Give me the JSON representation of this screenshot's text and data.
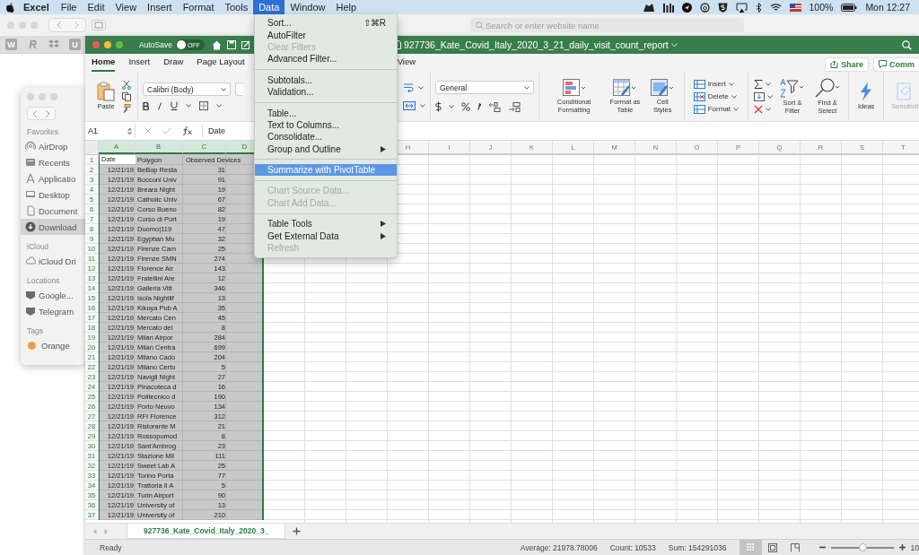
{
  "menubar": {
    "app": "Excel",
    "items": [
      {
        "label": "File",
        "selected": false
      },
      {
        "label": "Edit",
        "selected": false
      },
      {
        "label": "View",
        "selected": false
      },
      {
        "label": "Insert",
        "selected": false
      },
      {
        "label": "Format",
        "selected": false
      },
      {
        "label": "Tools",
        "selected": false
      },
      {
        "label": "Data",
        "selected": true
      },
      {
        "label": "Window",
        "selected": false
      },
      {
        "label": "Help",
        "selected": false
      }
    ],
    "battery": "100%",
    "clock": "Mon 12:27"
  },
  "browser": {
    "search": {
      "placeholder": "Search or enter website name"
    },
    "bookmarks": [
      {
        "kind": "letter",
        "label": "W"
      },
      {
        "kind": "italic",
        "label": "R"
      },
      {
        "kind": "dropbox"
      },
      {
        "kind": "letter",
        "label": "U"
      }
    ]
  },
  "finder": {
    "sections": [
      {
        "title": "Favorites",
        "items": [
          {
            "label": "AirDrop",
            "kind": "airdrop",
            "selected": false
          },
          {
            "label": "Recents",
            "kind": "recents",
            "selected": false
          },
          {
            "label": "Applicatio",
            "kind": "applications",
            "selected": false
          },
          {
            "label": "Desktop",
            "kind": "desktop",
            "selected": false
          },
          {
            "label": "Document",
            "kind": "documents",
            "selected": false
          },
          {
            "label": "Download",
            "kind": "downloads",
            "selected": true
          }
        ]
      },
      {
        "title": "iCloud",
        "items": [
          {
            "label": "iCloud Dri",
            "kind": "cloud",
            "selected": false
          }
        ]
      },
      {
        "title": "Locations",
        "items": [
          {
            "label": "Google...",
            "kind": "drive",
            "selected": false
          },
          {
            "label": "Telegram",
            "kind": "drive",
            "selected": false
          }
        ]
      },
      {
        "title": "Tags",
        "items": [
          {
            "label": "Orange",
            "kind": "tag",
            "color": "#f0a044",
            "selected": false
          }
        ]
      }
    ]
  },
  "excel": {
    "autosave": {
      "label": "AutoSave",
      "on": false,
      "state": "OFF"
    },
    "title": "927736_Kate_Covid_Italy_2020_3_21_daily_visit_count_report",
    "tabs": [
      {
        "label": "Home",
        "selected": true
      },
      {
        "label": "Insert",
        "selected": false
      },
      {
        "label": "Draw",
        "selected": false
      },
      {
        "label": "Page Layout",
        "selected": false
      },
      {
        "label": "View",
        "selected": false
      }
    ],
    "share": "Share",
    "comments": "Comm",
    "ribbon": {
      "paste": "Paste",
      "font": "Calibri (Body)",
      "number_format": "General",
      "style_buttons": [
        "Conditional Formatting",
        "Format as Table",
        "Cell Styles"
      ],
      "cell_buttons": [
        "Insert",
        "Delete",
        "Format"
      ],
      "sort_filter": "Sort & Filter",
      "find_select": "Find & Select",
      "ideas": "Ideas",
      "sensitivity": "Sensitivit"
    },
    "formula_bar": {
      "name_box": "A1",
      "formula": "Date"
    },
    "columns_left": [
      {
        "label": "A",
        "selected": true
      },
      {
        "label": "B",
        "selected": true
      },
      {
        "label": "C",
        "selected": true
      },
      {
        "label": "D",
        "selected": true
      }
    ],
    "columns_right": [
      {
        "label": "H",
        "selected": false
      },
      {
        "label": "I",
        "selected": false
      },
      {
        "label": "J",
        "selected": false
      },
      {
        "label": "K",
        "selected": false
      },
      {
        "label": "L",
        "selected": false
      },
      {
        "label": "M",
        "selected": false
      },
      {
        "label": "N",
        "selected": false
      },
      {
        "label": "O",
        "selected": false
      },
      {
        "label": "P",
        "selected": false
      },
      {
        "label": "Q",
        "selected": false
      },
      {
        "label": "R",
        "selected": false
      },
      {
        "label": "S",
        "selected": false
      },
      {
        "label": "T",
        "selected": false
      }
    ],
    "rows": [
      {
        "number": "1",
        "cells": [
          "Date",
          "Polygon",
          "Observed Devices"
        ],
        "active": true
      },
      {
        "number": "2",
        "cells": [
          "12/21/19",
          "BeBop Resta",
          "31"
        ],
        "active": false
      },
      {
        "number": "3",
        "cells": [
          "12/21/19",
          "Bocconi Univ",
          "91"
        ],
        "active": false
      },
      {
        "number": "4",
        "cells": [
          "12/21/19",
          "Breara Night",
          "19"
        ],
        "active": false
      },
      {
        "number": "5",
        "cells": [
          "12/21/19",
          "Catholic Univ",
          "67"
        ],
        "active": false
      },
      {
        "number": "6",
        "cells": [
          "12/21/19",
          "Corso Bueno",
          "82"
        ],
        "active": false
      },
      {
        "number": "7",
        "cells": [
          "12/21/19",
          "Corso di Port",
          "19"
        ],
        "active": false
      },
      {
        "number": "8",
        "cells": [
          "12/21/19",
          "Duomo|119",
          "47"
        ],
        "active": false
      },
      {
        "number": "9",
        "cells": [
          "12/21/19",
          "Egyptian Mu",
          "32"
        ],
        "active": false
      },
      {
        "number": "10",
        "cells": [
          "12/21/19",
          "Firenze Cam",
          "25"
        ],
        "active": false
      },
      {
        "number": "11",
        "cells": [
          "12/21/19",
          "Firenze SMN",
          "274"
        ],
        "active": false
      },
      {
        "number": "12",
        "cells": [
          "12/21/19",
          "Florence Air",
          "143"
        ],
        "active": false
      },
      {
        "number": "13",
        "cells": [
          "12/21/19",
          "Fratellini Are",
          "12"
        ],
        "active": false
      },
      {
        "number": "14",
        "cells": [
          "12/21/19",
          "Galleria Vitt",
          "346"
        ],
        "active": false
      },
      {
        "number": "15",
        "cells": [
          "12/21/19",
          "Isola Nightlif",
          "13"
        ],
        "active": false
      },
      {
        "number": "16",
        "cells": [
          "12/21/19",
          "Kikuya Pub A",
          "35"
        ],
        "active": false
      },
      {
        "number": "17",
        "cells": [
          "12/21/19",
          "Mercato Cen",
          "45"
        ],
        "active": false
      },
      {
        "number": "18",
        "cells": [
          "12/21/19",
          "Mercato del",
          "8"
        ],
        "active": false
      },
      {
        "number": "19",
        "cells": [
          "12/21/19",
          "Milan Airpor",
          "284"
        ],
        "active": false
      },
      {
        "number": "20",
        "cells": [
          "12/21/19",
          "Milan Centra",
          "699"
        ],
        "active": false
      },
      {
        "number": "21",
        "cells": [
          "12/21/19",
          "Milano Cado",
          "204"
        ],
        "active": false
      },
      {
        "number": "22",
        "cells": [
          "12/21/19",
          "Milano Certo",
          "5"
        ],
        "active": false
      },
      {
        "number": "23",
        "cells": [
          "12/21/19",
          "Navigli Night",
          "27"
        ],
        "active": false
      },
      {
        "number": "24",
        "cells": [
          "12/21/19",
          "Pinacoteca d",
          "16"
        ],
        "active": false
      },
      {
        "number": "25",
        "cells": [
          "12/21/19",
          "Politecnico d",
          "190"
        ],
        "active": false
      },
      {
        "number": "26",
        "cells": [
          "12/21/19",
          "Porto Neuvo",
          "134"
        ],
        "active": false
      },
      {
        "number": "27",
        "cells": [
          "12/21/19",
          "RFI Florence",
          "312"
        ],
        "active": false
      },
      {
        "number": "28",
        "cells": [
          "12/21/19",
          "Ristorante M",
          "21"
        ],
        "active": false
      },
      {
        "number": "29",
        "cells": [
          "12/21/19",
          "Rossopomod",
          "8"
        ],
        "active": false
      },
      {
        "number": "30",
        "cells": [
          "12/21/19",
          "Sant'Ambrog",
          "23"
        ],
        "active": false
      },
      {
        "number": "31",
        "cells": [
          "12/21/19",
          "Stazione Mil",
          "111"
        ],
        "active": false
      },
      {
        "number": "32",
        "cells": [
          "12/21/19",
          "Sweet Lab A",
          "25"
        ],
        "active": false
      },
      {
        "number": "33",
        "cells": [
          "12/21/19",
          "Torino Porta",
          "77"
        ],
        "active": false
      },
      {
        "number": "34",
        "cells": [
          "12/21/19",
          "Trattoria Il A",
          "5"
        ],
        "active": false
      },
      {
        "number": "35",
        "cells": [
          "12/21/19",
          "Turin Airport",
          "90"
        ],
        "active": false
      },
      {
        "number": "36",
        "cells": [
          "12/21/19",
          "University of",
          "13"
        ],
        "active": false
      },
      {
        "number": "37",
        "cells": [
          "12/21/19",
          "University of",
          "210"
        ],
        "active": false
      }
    ],
    "sheet_tabs": [
      {
        "label": "927736_Kate_Covid_Italy_2020_3_",
        "selected": true
      }
    ],
    "status": {
      "mode": "Ready",
      "average": "Average: 21978.78006",
      "count": "Count: 10533",
      "sum": "Sum: 154291036",
      "views": [
        {
          "kind": "normal",
          "selected": true
        },
        {
          "kind": "page_break",
          "selected": false
        },
        {
          "kind": "page_layout",
          "selected": false
        }
      ],
      "zoom": {
        "level": 0.5,
        "reading": "10"
      }
    }
  },
  "data_menu": [
    {
      "kind": "item",
      "label": "Sort...",
      "shortcut": "⇧⌘R",
      "disabled": false,
      "selected": false,
      "submenu": false
    },
    {
      "kind": "item",
      "label": "AutoFilter",
      "disabled": false,
      "selected": false,
      "submenu": false
    },
    {
      "kind": "item",
      "label": "Clear Filters",
      "disabled": true,
      "selected": false,
      "submenu": false
    },
    {
      "kind": "item",
      "label": "Advanced Filter...",
      "disabled": false,
      "selected": false,
      "submenu": false
    },
    {
      "kind": "separator"
    },
    {
      "kind": "item",
      "label": "Subtotals...",
      "disabled": false,
      "selected": false,
      "submenu": false
    },
    {
      "kind": "item",
      "label": "Validation...",
      "disabled": false,
      "selected": false,
      "submenu": false
    },
    {
      "kind": "separator"
    },
    {
      "kind": "item",
      "label": "Table...",
      "disabled": false,
      "selected": false,
      "submenu": false
    },
    {
      "kind": "item",
      "label": "Text to Columns...",
      "disabled": false,
      "selected": false,
      "submenu": false
    },
    {
      "kind": "item",
      "label": "Consolidate...",
      "disabled": false,
      "selected": false,
      "submenu": false
    },
    {
      "kind": "item",
      "label": "Group and Outline",
      "disabled": false,
      "selected": false,
      "submenu": true
    },
    {
      "kind": "separator"
    },
    {
      "kind": "item",
      "label": "Summarize with PivotTable",
      "disabled": false,
      "selected": true,
      "submenu": false
    },
    {
      "kind": "separator"
    },
    {
      "kind": "item",
      "label": "Chart Source Data...",
      "disabled": true,
      "selected": false,
      "submenu": false
    },
    {
      "kind": "item",
      "label": "Chart Add Data...",
      "disabled": true,
      "selected": false,
      "submenu": false
    },
    {
      "kind": "separator"
    },
    {
      "kind": "item",
      "label": "Table Tools",
      "disabled": false,
      "selected": false,
      "submenu": true
    },
    {
      "kind": "item",
      "label": "Get External Data",
      "disabled": false,
      "selected": false,
      "submenu": true
    },
    {
      "kind": "item",
      "label": "Refresh",
      "disabled": true,
      "selected": false,
      "submenu": false
    }
  ]
}
